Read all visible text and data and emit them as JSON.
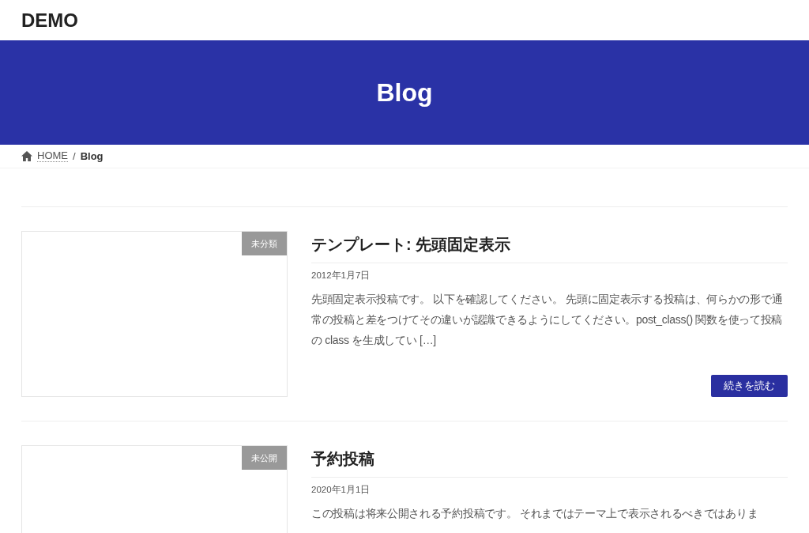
{
  "site_title": "DEMO",
  "page_title": "Blog",
  "breadcrumb": [
    {
      "label": "HOME",
      "kind": "home"
    },
    {
      "label": "/",
      "kind": "separator"
    },
    {
      "label": "Blog",
      "kind": "current"
    }
  ],
  "posts": [
    {
      "category": "未分類",
      "title": "テンプレート: 先頭固定表示",
      "date": "2012年1月7日",
      "excerpt": "先頭固定表示投稿です。 以下を確認してください。 先頭に固定表示する投稿は、何らかの形で通常の投稿と差をつけてその違いが認識できるようにしてください。post_class() 関数を使って投稿の class を生成してい […]",
      "button": "続きを読む"
    },
    {
      "category": "未公開",
      "title": "予約投稿",
      "date": "2020年1月1日",
      "excerpt": "この投稿は将来公開される予約投稿です。 それまではテーマ上で表示されるべきではありま"
    }
  ]
}
